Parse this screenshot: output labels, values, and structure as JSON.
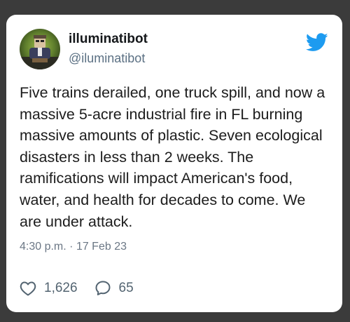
{
  "tweet": {
    "display_name": "illuminatibot",
    "handle": "@iluminatibot",
    "text": "Five trains derailed, one truck spill, and now a massive 5-acre industrial fire in FL burning massive amounts of plastic. Seven ecological disasters in less than 2 weeks. The ramifications will impact American's food, water, and health for decades to come. We are under attack.",
    "time": "4:30 p.m.",
    "separator": "·",
    "date": "17 Feb 23",
    "likes": "1,626",
    "replies": "65"
  },
  "icons": {
    "brand": "twitter-bird-icon",
    "like": "heart-outline-icon",
    "reply": "speech-bubble-icon"
  },
  "colors": {
    "card_background": "#ffffff",
    "frame_background": "#3b3b3b",
    "twitter_blue": "#1d9bf0",
    "muted_text": "#6b7785",
    "body_text": "#1c1c1c"
  }
}
